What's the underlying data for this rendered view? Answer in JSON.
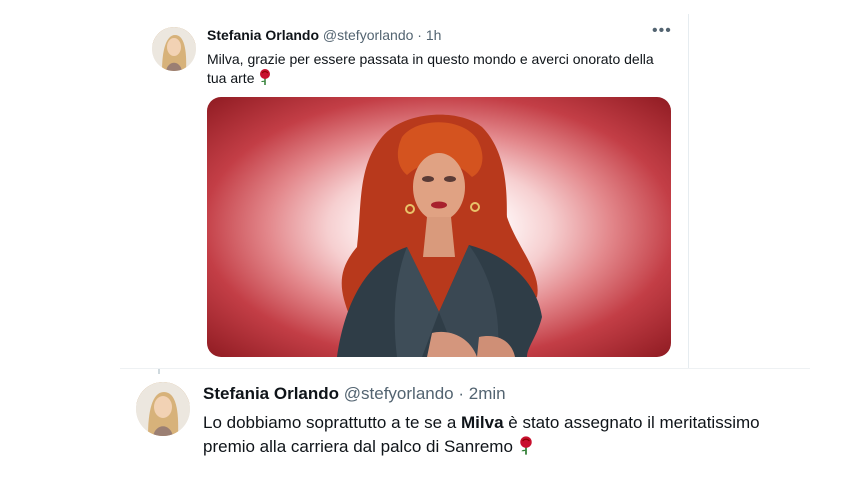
{
  "tweet1": {
    "author_name": "Stefania Orlando",
    "handle": "@stefyorlando",
    "separator": "·",
    "time": "1h",
    "more_icon": "more-dots-icon",
    "text": "Milva, grazie per essere passata in questo mondo e averci onorato della tua arte",
    "emoji": "rose-emoji"
  },
  "tweet2": {
    "author_name": "Stefania Orlando",
    "handle": "@stefyorlando",
    "separator": "·",
    "time": "2min",
    "text_before": "Lo dobbiamo soprattutto a te se a ",
    "text_bold": "Milva",
    "text_after": " è stato assegnato il meritatissimo premio alla carriera dal palco di Sanremo",
    "emoji": "rose-emoji"
  },
  "colors": {
    "text": "#0f1419",
    "meta": "#536471",
    "rose": "#c8102e",
    "media_outer": "#8f1b22"
  }
}
